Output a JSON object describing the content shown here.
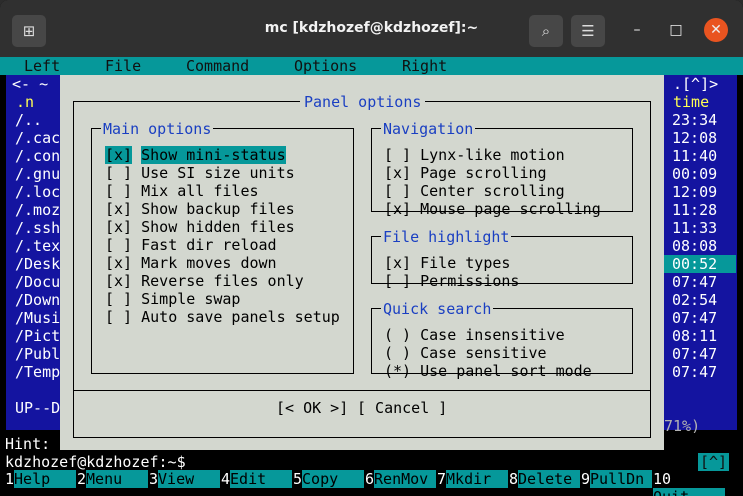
{
  "window": {
    "title": "mc [kdzhozef@kdzhozef]:~"
  },
  "menu": [
    "Left",
    "File",
    "Command",
    "Options",
    "Right"
  ],
  "left_panel": {
    "header": "<- ~",
    "column": ".n",
    "entries": [
      "/..",
      "/.cac",
      "/.con",
      "/.gnu",
      "/.loc",
      "/.moz",
      "/.ssh",
      "/.tex",
      "/Desk",
      "/Docu",
      "/Down",
      "/Musi",
      "/Pict",
      "/Publ",
      "/Temp"
    ],
    "footer": "UP--D"
  },
  "right_panel": {
    "header": ".[^]>",
    "column": "time",
    "times": [
      "23:34",
      "12:08",
      "11:40",
      "00:09",
      "12:09",
      "11:28",
      "11:33",
      "08:08",
      "00:52",
      "07:47",
      "02:54",
      "07:47",
      "08:11",
      "07:47",
      "07:47"
    ],
    "footer": "71%)"
  },
  "dialog": {
    "title": "Panel options",
    "main_options": {
      "title": "Main options",
      "items": [
        {
          "mark": "[x]",
          "label": "Show mini-status"
        },
        {
          "mark": "[ ]",
          "label": "Use SI size units"
        },
        {
          "mark": "[ ]",
          "label": "Mix all files"
        },
        {
          "mark": "[x]",
          "label": "Show backup files"
        },
        {
          "mark": "[x]",
          "label": "Show hidden files"
        },
        {
          "mark": "[ ]",
          "label": "Fast dir reload"
        },
        {
          "mark": "[x]",
          "label": "Mark moves down"
        },
        {
          "mark": "[x]",
          "label": "Reverse files only"
        },
        {
          "mark": "[ ]",
          "label": "Simple swap"
        },
        {
          "mark": "[ ]",
          "label": "Auto save panels setup"
        }
      ]
    },
    "navigation": {
      "title": "Navigation",
      "items": [
        {
          "mark": "[ ]",
          "label": "Lynx-like motion"
        },
        {
          "mark": "[x]",
          "label": "Page scrolling"
        },
        {
          "mark": "[ ]",
          "label": "Center scrolling"
        },
        {
          "mark": "[x]",
          "label": "Mouse page scrolling"
        }
      ]
    },
    "file_highlight": {
      "title": "File highlight",
      "items": [
        {
          "mark": "[x]",
          "label": "File types"
        },
        {
          "mark": "[ ]",
          "label": "Permissions"
        }
      ]
    },
    "quick_search": {
      "title": "Quick search",
      "items": [
        {
          "mark": "( )",
          "label": "Case insensitive"
        },
        {
          "mark": "( )",
          "label": "Case sensitive"
        },
        {
          "mark": "(*)",
          "label": "Use panel sort mode"
        }
      ]
    },
    "ok_label": "[< OK >]",
    "cancel_label": "[ Cancel ]"
  },
  "hint": "Hint:",
  "prompt": "kdzhozef@kdzhozef:~$",
  "prompt_right": "[^]",
  "fkeys": [
    {
      "n": "1",
      "label": "Help"
    },
    {
      "n": "2",
      "label": "Menu"
    },
    {
      "n": "3",
      "label": "View"
    },
    {
      "n": "4",
      "label": "Edit"
    },
    {
      "n": "5",
      "label": "Copy"
    },
    {
      "n": "6",
      "label": "RenMov"
    },
    {
      "n": "7",
      "label": "Mkdir"
    },
    {
      "n": "8",
      "label": "Delete"
    },
    {
      "n": "9",
      "label": "PullDn"
    },
    {
      "n": "10",
      "label": "Quit"
    }
  ],
  "colors": {
    "titlebar": "#303030",
    "close": "#e95420",
    "menubar": "#06989a",
    "panel": "#1414a0",
    "dialog": "#d3d7cf",
    "highlight": "#1a3fc2"
  }
}
